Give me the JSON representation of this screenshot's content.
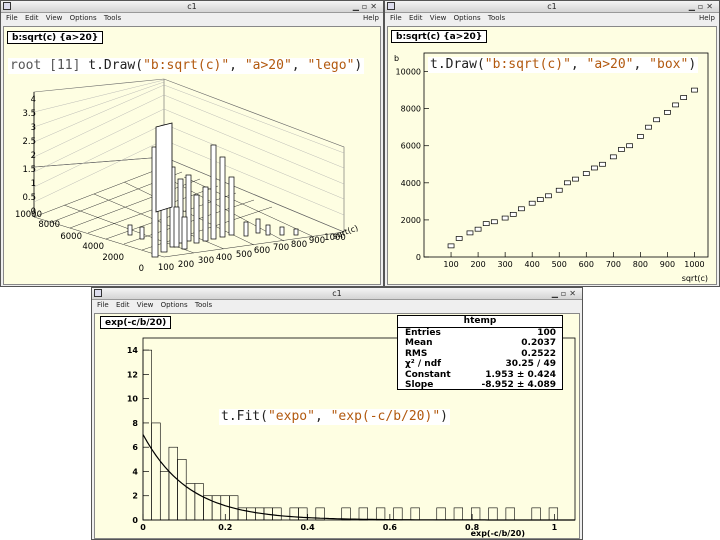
{
  "win1": {
    "title": "c1",
    "menu": [
      "File",
      "Edit",
      "View",
      "Options",
      "Tools"
    ],
    "help": "Help",
    "hist_label": "b:sqrt(c) {a>20}",
    "command": {
      "prompt": "root [11] ",
      "call": "t.Draw(",
      "arg1": "\"b:sqrt(c)\"",
      "sep1": ", ",
      "arg2": "\"a>20\"",
      "sep2": ", ",
      "arg3": "\"lego\"",
      "close": ")"
    },
    "z_ticks": [
      "0",
      "0.5",
      "1",
      "1.5",
      "2",
      "2.5",
      "3",
      "3.5",
      "4"
    ],
    "y_ticks": [
      "0",
      "2000",
      "4000",
      "6000",
      "8000",
      "10000"
    ],
    "x_ticks": [
      "100",
      "200",
      "300",
      "400",
      "500",
      "600",
      "700",
      "800",
      "900",
      "1000"
    ],
    "x_label": "sqrt(c)"
  },
  "win2": {
    "title": "c1",
    "menu": [
      "File",
      "Edit",
      "View",
      "Options",
      "Tools"
    ],
    "help": "Help",
    "hist_label": "b:sqrt(c) {a>20}",
    "command": {
      "call": "t.Draw(",
      "arg1": "\"b:sqrt(c)\"",
      "sep1": ", ",
      "arg2": "\"a>20\"",
      "sep2": ", ",
      "arg3": "\"box\"",
      "close": ")"
    },
    "y_axis_letter": "b",
    "x_label": "sqrt(c)"
  },
  "win3": {
    "title": "c1",
    "menu": [
      "File",
      "Edit",
      "View",
      "Options",
      "Tools"
    ],
    "help": "Help",
    "hist_label": "exp(-c/b/20)",
    "command": {
      "call": "t.Fit(",
      "arg1": "\"expo\"",
      "sep1": ", ",
      "arg2": "\"exp(-c/b/20)\"",
      "close": ")"
    },
    "x_label": "exp(-c/b/20)",
    "stats": {
      "title": "htemp",
      "rows": [
        {
          "k": "Entries",
          "v": "100"
        },
        {
          "k": "Mean",
          "v": "0.2037"
        },
        {
          "k": "RMS",
          "v": "0.2522"
        },
        {
          "k": "χ² / ndf",
          "v": "30.25 / 49"
        },
        {
          "k": "Constant",
          "v": "1.953 ± 0.424"
        },
        {
          "k": "Slope",
          "v": "-8.952 ± 4.089"
        }
      ]
    }
  },
  "chart_data": [
    {
      "type": "bar",
      "title": "b:sqrt(c) {a>20}",
      "xlabel": "sqrt(c)",
      "ylabel": "",
      "xlim": [
        0,
        1050
      ],
      "ylim": [
        0,
        11000
      ],
      "style": "box",
      "points": [
        [
          100,
          600
        ],
        [
          130,
          1000
        ],
        [
          170,
          1300
        ],
        [
          200,
          1500
        ],
        [
          230,
          1800
        ],
        [
          260,
          1900
        ],
        [
          300,
          2100
        ],
        [
          330,
          2300
        ],
        [
          360,
          2600
        ],
        [
          400,
          2900
        ],
        [
          430,
          3100
        ],
        [
          460,
          3300
        ],
        [
          500,
          3600
        ],
        [
          530,
          4000
        ],
        [
          560,
          4200
        ],
        [
          600,
          4500
        ],
        [
          630,
          4800
        ],
        [
          660,
          5000
        ],
        [
          700,
          5400
        ],
        [
          730,
          5800
        ],
        [
          760,
          6000
        ],
        [
          800,
          6500
        ],
        [
          830,
          7000
        ],
        [
          860,
          7400
        ],
        [
          900,
          7800
        ],
        [
          930,
          8200
        ],
        [
          960,
          8600
        ],
        [
          1000,
          9000
        ]
      ]
    },
    {
      "type": "bar",
      "title": "exp(-c/b/20)",
      "xlabel": "exp(-c/b/20)",
      "ylabel": "",
      "xlim": [
        0,
        1.05
      ],
      "ylim": [
        0,
        15
      ],
      "bin_width": 0.021,
      "series": [
        {
          "name": "",
          "x": [
            0,
            0.021,
            0.042,
            0.063,
            0.084,
            0.105,
            0.126,
            0.147,
            0.168,
            0.189,
            0.21,
            0.231,
            0.252,
            0.273,
            0.294,
            0.315,
            0.336,
            0.357,
            0.378,
            0.399,
            0.42,
            0.441,
            0.462,
            0.483,
            0.504,
            0.525,
            0.546,
            0.567,
            0.588,
            0.609,
            0.63,
            0.651,
            0.672,
            0.693,
            0.714,
            0.735,
            0.756,
            0.777,
            0.798,
            0.819,
            0.84,
            0.861,
            0.882,
            0.903,
            0.924,
            0.945,
            0.966,
            0.987
          ],
          "values": [
            14,
            8,
            4,
            6,
            5,
            3,
            3,
            2,
            2,
            2,
            2,
            1,
            1,
            1,
            1,
            1,
            0,
            1,
            1,
            0,
            1,
            0,
            0,
            1,
            0,
            1,
            0,
            1,
            0,
            1,
            0,
            1,
            0,
            0,
            1,
            0,
            1,
            0,
            1,
            0,
            1,
            0,
            1,
            0,
            0,
            1,
            0,
            1
          ]
        },
        {
          "name": "expo",
          "fit": {
            "Constant": 1.953,
            "Slope": -8.952
          }
        }
      ]
    }
  ]
}
